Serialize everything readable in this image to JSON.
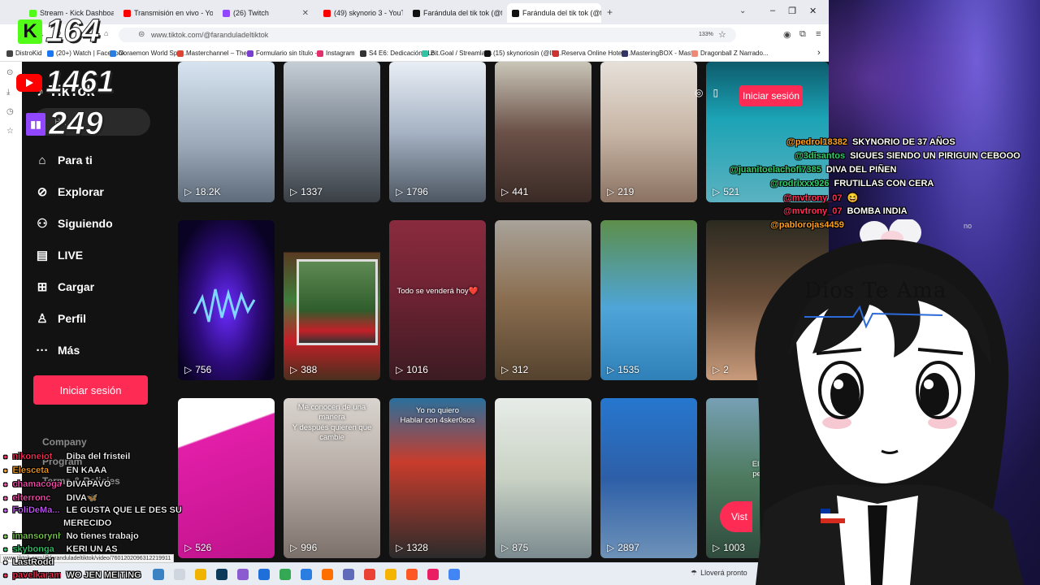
{
  "tabs": [
    {
      "label": "Stream - Kick Dashboard",
      "color": "#53fc18"
    },
    {
      "label": "Transmisión en vivo - YouTube",
      "color": "#ff0000"
    },
    {
      "label": "(26) Twitch",
      "color": "#9146ff"
    },
    {
      "label": "(49) skynorio 3 - YouTube",
      "color": "#ff0000"
    },
    {
      "label": "Farándula del tik tok (@farandu",
      "color": "#111111"
    },
    {
      "label": "Farándula del tik tok (@farandu",
      "color": "#111111"
    }
  ],
  "address_bar": {
    "url": "www.tiktok.com/@faranduladeltiktok",
    "zoom": "133%"
  },
  "bookmarks": [
    "DistroKid",
    "(20+) Watch | Facebook",
    "Doraemon World Spai...",
    "Masterchannel – The...",
    "Formulario sin título -...",
    "Instagram",
    "S4 E6: Dedicación | Lo...",
    "Bit Goal / Streamlabs",
    "(15) skynoriosin (@ID...",
    "Reserva Online Hotele...",
    "MasteringBOX - Mast...",
    "Dragonball Z Narrado..."
  ],
  "tiktok": {
    "brand": "TikTok",
    "search_label": "Bu",
    "nav": [
      {
        "label": "Para ti",
        "icon": "home-icon",
        "glyph": "⌂"
      },
      {
        "label": "Explorar",
        "icon": "compass-icon",
        "glyph": "⊘"
      },
      {
        "label": "Siguiendo",
        "icon": "following-icon",
        "glyph": "⚇"
      },
      {
        "label": "LIVE",
        "icon": "live-icon",
        "glyph": "▤"
      },
      {
        "label": "Cargar",
        "icon": "upload-icon",
        "glyph": "⊞"
      },
      {
        "label": "Perfil",
        "icon": "profile-icon",
        "glyph": "♙"
      },
      {
        "label": "Más",
        "icon": "more-icon",
        "glyph": "···"
      }
    ],
    "login_label": "Iniciar sesión",
    "top_login_label": "Iniciar sesión",
    "footer": {
      "company": "Company",
      "program": "Program",
      "terms": "Terms & Policies"
    },
    "visit_label": "Vist",
    "videos": [
      {
        "views": "18.2K",
        "caption": "",
        "bg": "linear-gradient(180deg,#d7e4f0,#9aa8b8 60%,#5d6b7a)"
      },
      {
        "views": "1337",
        "caption": "",
        "bg": "linear-gradient(180deg,#c5cdd5,#7d8792 50%,#3a3f45)"
      },
      {
        "views": "1796",
        "caption": "",
        "bg": "linear-gradient(180deg,#e9eef5,#a6b3c4 50%,#4d5662)"
      },
      {
        "views": "441",
        "caption": "",
        "bg": "linear-gradient(180deg,#c9c6b8,#6b5148 50%,#3a2a25)"
      },
      {
        "views": "219",
        "caption": "",
        "bg": "linear-gradient(180deg,#e6e0d9,#c8b6a6 50%,#8b7262)"
      },
      {
        "views": "521",
        "caption": "",
        "bg": "linear-gradient(180deg,#0d5b6b,#1ba3b5 40%,#5bb2c0)"
      },
      {
        "views": "756",
        "caption": "",
        "bg": "radial-gradient(ellipse at 50% 55%,#6a2cff,#2d0b7a 45%,#0a0324 80%)"
      },
      {
        "views": "388",
        "caption": "",
        "bg": "linear-gradient(180deg,#121212 0%,#121212 20%,#5a3a22 20%,#3f7d3a 50%,#c42028 75%,#4a2f1e 100%)"
      },
      {
        "views": "1016",
        "caption": "Todo se venderá hoy❤️",
        "bg": "linear-gradient(180deg,#8a2b3e,#6b2232 50%,#3b1b22)"
      },
      {
        "views": "312",
        "caption": "",
        "bg": "linear-gradient(180deg,#a9a39a,#8a6d4f 50%,#55432f)"
      },
      {
        "views": "1535",
        "caption": "",
        "bg": "linear-gradient(180deg,#5d8e4a,#4ea5d8 55%,#2f80b8)"
      },
      {
        "views": "2",
        "caption": "",
        "bg": "linear-gradient(180deg,#2c2a20,#6b4f3a 50%,#c89b7b)"
      },
      {
        "views": "526",
        "caption": "",
        "bg": "linear-gradient(160deg,#ffffff 25%,#e21ea8 26%,#c0138d 100%)"
      },
      {
        "views": "996",
        "caption": "Me conocen de una manera\nY después quieren que cambie",
        "bg": "linear-gradient(180deg,#d9d4cf,#b5aaa3 50%,#7c706a)"
      },
      {
        "views": "1328",
        "caption": "Yo no quiero\nHablar con 4sker0sos",
        "bg": "linear-gradient(180deg,#2a6f9c,#c83c2c 40%,#2b2b2b)"
      },
      {
        "views": "875",
        "caption": "",
        "bg": "linear-gradient(180deg,#e7ece8,#c9d2c4 50%,#7b8a8f)"
      },
      {
        "views": "2897",
        "caption": "",
        "bg": "linear-gradient(180deg,#2677cf,#2d5fa8 50%,#6e92b8)"
      },
      {
        "views": "1003",
        "caption": "El dueño\npelea po",
        "bg": "linear-gradient(180deg,#77a0b5,#4d7a5e 50%,#2f4b3d)"
      }
    ]
  },
  "overlay": {
    "kick_count": "164",
    "youtube_count": "1461",
    "twitch_count": "249",
    "left_chat": [
      {
        "user": "nikoneiot",
        "color": "#ff2d55",
        "msg": "Diba del fristeil"
      },
      {
        "user": "Elesceta",
        "color": "#ff9f1c",
        "msg": "EN KAAA"
      },
      {
        "user": "chamacogamer",
        "color": "#ff4fb0",
        "msg": "DIVAPAVO"
      },
      {
        "user": "elterronc",
        "color": "#ff4fb0",
        "msg": "DIVA🦋"
      },
      {
        "user": "FoliDeMa...",
        "color": "#c85cff",
        "msg": "LE GUSTA QUE LE DES SU"
      },
      {
        "user": "",
        "color": "#ffffff",
        "msg": "MERECIDO"
      },
      {
        "user": "imansorynho",
        "color": "#7bd34a",
        "msg": "No tienes trabajo"
      },
      {
        "user": "skybonga",
        "color": "#2ecf6a",
        "msg": "KERI UN AS"
      },
      {
        "user": "LastRodd",
        "color": "#ffffff",
        "msg": ""
      },
      {
        "user": "pavelkaramaz",
        "color": "#ff2d55",
        "msg": "WO JEN MEITING"
      }
    ],
    "right_chat": [
      {
        "user": "@pedrol18382",
        "color": "#ff9f1c",
        "msg": "SKYNORIO DE 37 AÑOS"
      },
      {
        "user": "@3disantos",
        "color": "#2ecf6a",
        "msg": "SIGUES SIENDO UN PIRIGUIN CEBOOO"
      },
      {
        "user": "@juanitoelachofi7385",
        "color": "#2ecf6a",
        "msg": "DIVA DEL PIÑEN"
      },
      {
        "user": "@rodrixxx926",
        "color": "#2ecf6a",
        "msg": "FRUTILLAS CON CERA"
      },
      {
        "user": "@mvtrony_07",
        "color": "#ff2d55",
        "msg": "😆"
      },
      {
        "user": "@mvtrony_07",
        "color": "#ff2d55",
        "msg": "BOMBA INDIA"
      },
      {
        "user": "@pablorojas4459",
        "color": "#ff9f1c",
        "msg": ""
      }
    ],
    "stray_text": "no",
    "dios_text": "Dios Te Ama"
  },
  "status_url": "www.tiktok.com/@faranduladeltiktok/video/7601202096312219911",
  "weather": "Lloverá pronto"
}
